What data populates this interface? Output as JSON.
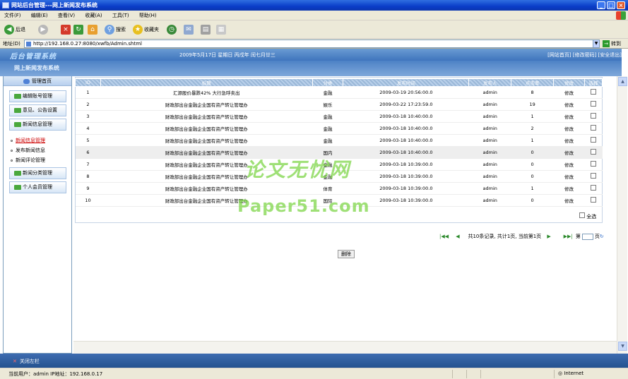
{
  "window": {
    "title": "网站后台管理---网上新闻发布系统"
  },
  "menu": [
    "文件(F)",
    "编辑(E)",
    "查看(V)",
    "收藏(A)",
    "工具(T)",
    "帮助(H)"
  ],
  "toolbar": {
    "back": "后退",
    "search": "搜索",
    "favorites": "收藏夹"
  },
  "address": {
    "label": "地址(D)",
    "url": "http://192.168.0.27:8080/xwfb/Admin.shtml",
    "go": "转到"
  },
  "header": {
    "logo": "后台管理系统",
    "date": "2009年5月17日 星期日 丙戌年 闰七月廿三",
    "links": "[网站首页] [修改密码] [安全退出]",
    "system_title": "网上新闻发布系统"
  },
  "sidebar": {
    "home": "管理首页",
    "items": [
      "编辑账号管理",
      "意见、公告设置",
      "新闻信息管理"
    ],
    "subitems": [
      "新闻信息管理",
      "发布新闻信息",
      "新闻评论管理"
    ],
    "items2": [
      "新闻分类管理",
      "个人会员管理"
    ]
  },
  "table": {
    "headers": [
      "ID",
      "标题",
      "分类",
      "发布时间",
      "发布人",
      "点击率",
      "修改",
      "选择"
    ],
    "rows": [
      [
        "1",
        "汇源股价暴跌42% 大行急呼卖出",
        "金融",
        "2009-03-19 20:56:00.0",
        "admin",
        "8",
        "修改"
      ],
      [
        "2",
        "财政部出台金融企业国有资产转让管理办",
        "娱乐",
        "2009-03-22 17:23:59.0",
        "admin",
        "19",
        "修改"
      ],
      [
        "3",
        "财政部出台金融企业国有资产转让管理办",
        "金融",
        "2009-03-18 10:40:00.0",
        "admin",
        "1",
        "修改"
      ],
      [
        "4",
        "财政部出台金融企业国有资产转让管理办",
        "金融",
        "2009-03-18 10:40:00.0",
        "admin",
        "2",
        "修改"
      ],
      [
        "5",
        "财政部出台金融企业国有资产转让管理办",
        "金融",
        "2009-03-18 10:40:00.0",
        "admin",
        "1",
        "修改"
      ],
      [
        "6",
        "财政部出台金融企业国有资产转让管理办",
        "国内",
        "2009-03-18 10:40:00.0",
        "admin",
        "0",
        "修改"
      ],
      [
        "7",
        "财政部出台金融企业国有资产转让管理办",
        "金融",
        "2009-03-18 10:39:00.0",
        "admin",
        "0",
        "修改"
      ],
      [
        "8",
        "财政部出台金融企业国有资产转让管理办",
        "金融",
        "2009-03-18 10:39:00.0",
        "admin",
        "0",
        "修改"
      ],
      [
        "9",
        "财政部出台金融企业国有资产转让管理办",
        "体育",
        "2009-03-18 10:39:00.0",
        "admin",
        "1",
        "修改"
      ],
      [
        "10",
        "财政部出台金融企业国有资产转让管理办",
        "国际",
        "2009-03-18 10:39:00.0",
        "admin",
        "0",
        "修改"
      ]
    ],
    "select_all": "全选"
  },
  "pager": {
    "info": "共10条记录, 共计1页, 当前第1页",
    "page_prefix": "第",
    "page_suffix": "页"
  },
  "delete_button": "删除",
  "footer": {
    "close_left": "关闭左栏"
  },
  "status": {
    "left": "当前用户：admin  IP地址：192.168.0.17",
    "zone": "Internet"
  },
  "watermark": {
    "line1": "论文无忧网",
    "line2": "Paper51.com"
  }
}
